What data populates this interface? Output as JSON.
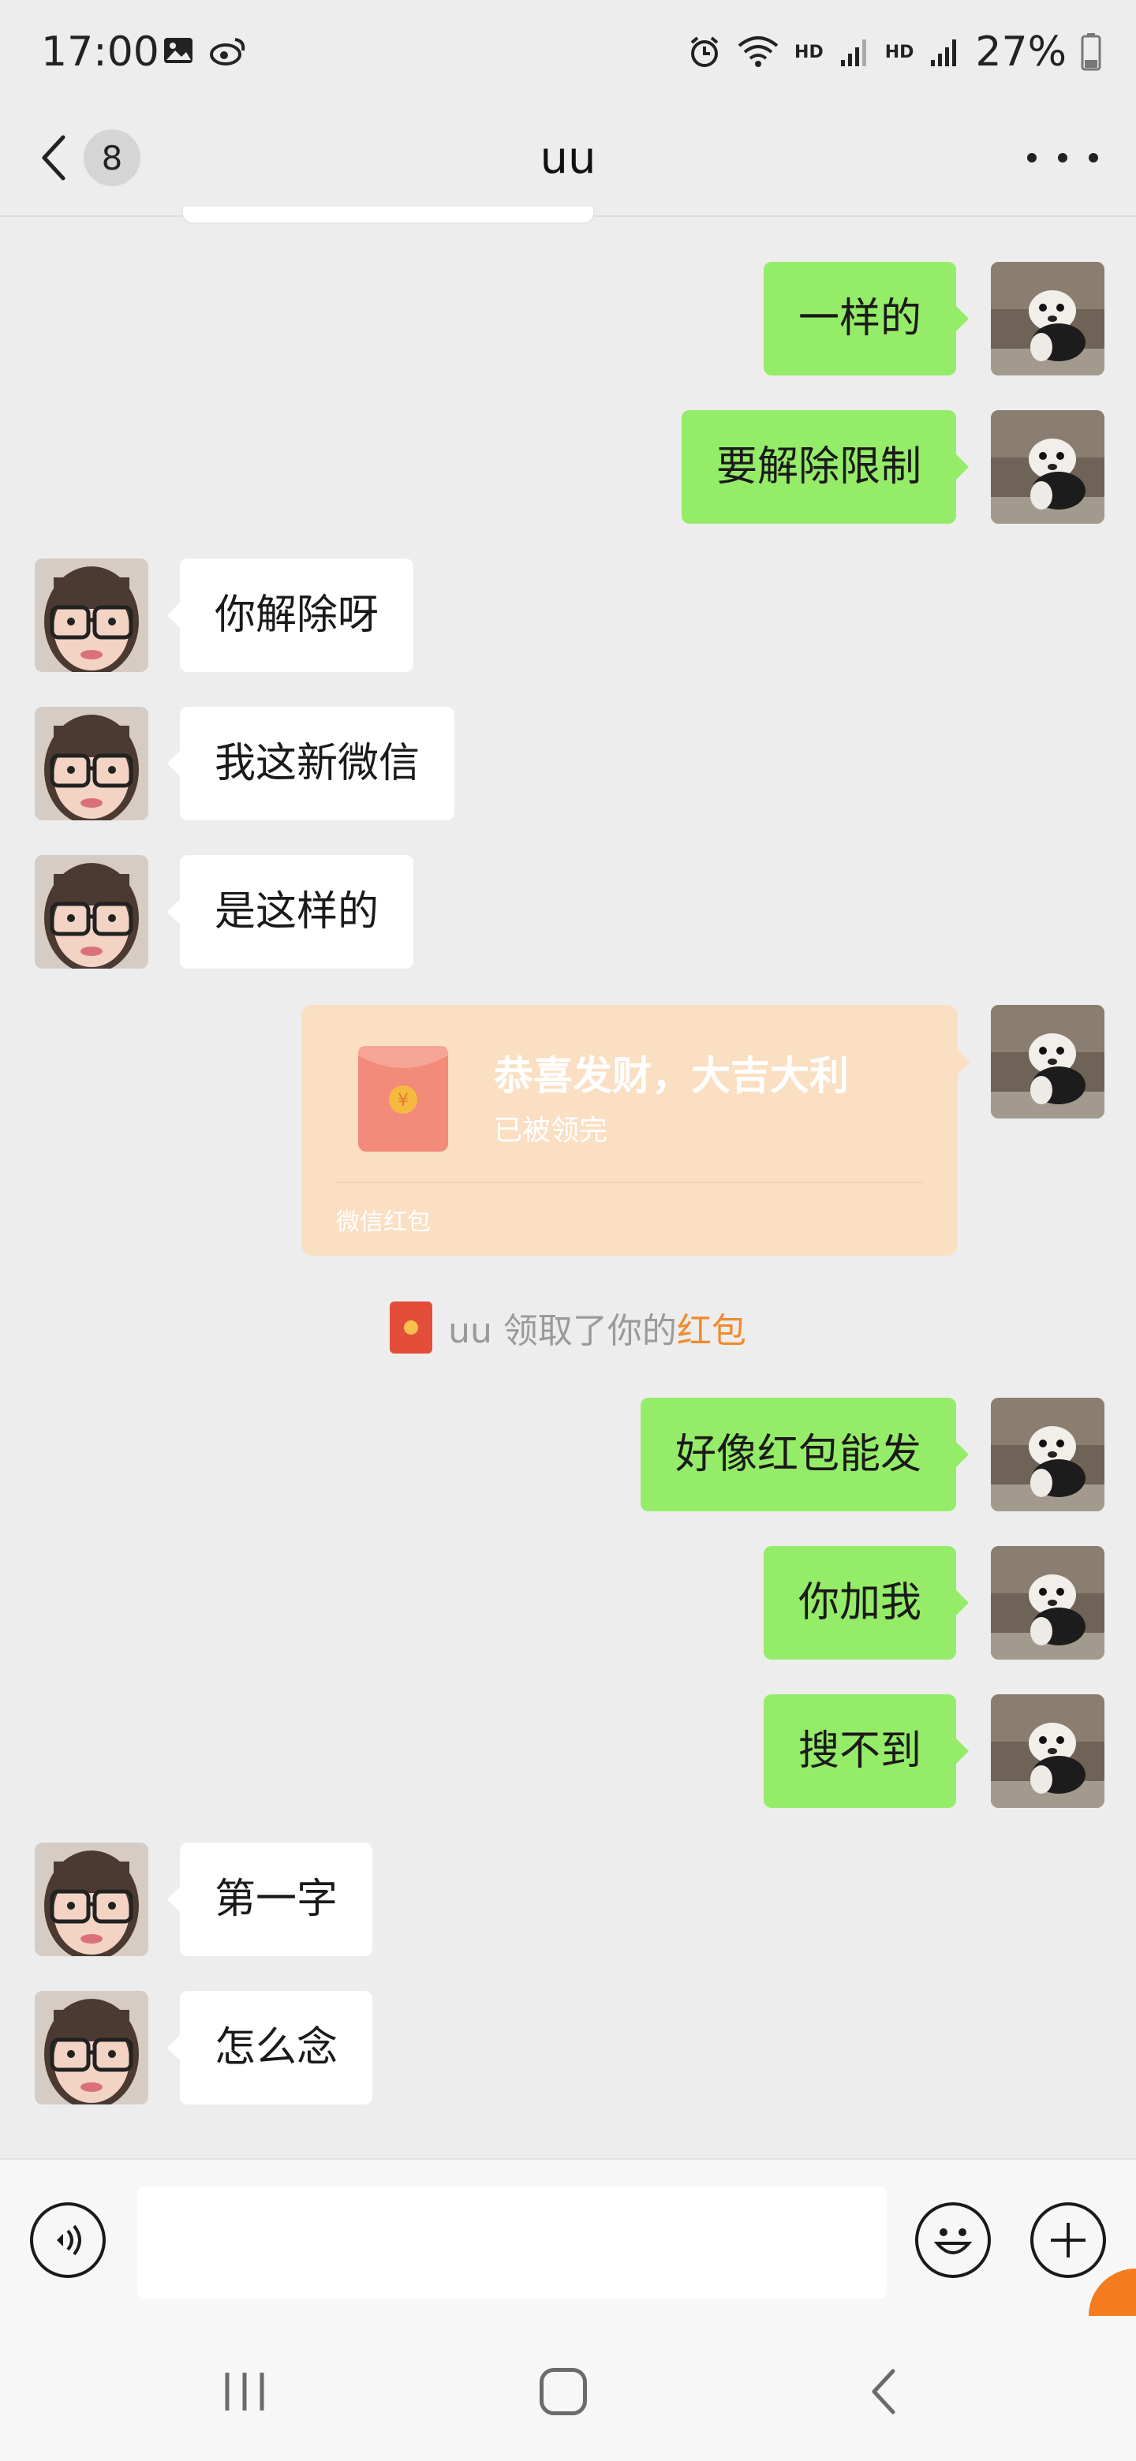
{
  "status_bar": {
    "time": "17:00",
    "hd_label": "HD",
    "battery": "27%"
  },
  "header": {
    "back_count": "8",
    "title": "uu"
  },
  "messages": [
    {
      "side": "me",
      "text": "一样的"
    },
    {
      "side": "me",
      "text": "要解除限制"
    },
    {
      "side": "other",
      "text": "你解除呀"
    },
    {
      "side": "other",
      "text": "我这新微信"
    },
    {
      "side": "other",
      "text": "是这样的"
    },
    {
      "side": "me",
      "text": "好像红包能发"
    },
    {
      "side": "me",
      "text": "你加我"
    },
    {
      "side": "me",
      "text": "搜不到"
    },
    {
      "side": "other",
      "text": "第一字"
    },
    {
      "side": "other",
      "text": "怎么念"
    }
  ],
  "red_packet": {
    "title": "恭喜发财，大吉大利",
    "status": "已被领完",
    "footer": "微信红包",
    "symbol": "¥"
  },
  "notice": {
    "prefix": "uu 领取了你的",
    "link": "红包"
  },
  "input": {
    "value": "",
    "placeholder": ""
  },
  "colors": {
    "my_bubble": "#95ec69",
    "other_bubble": "#ffffff",
    "background": "#ededed",
    "red_packet": "#fbdfc3",
    "notice_link": "#f08b2c"
  },
  "icons": {
    "back": "chevron-left-icon",
    "more": "more-dots-icon",
    "voice": "voice-icon",
    "emoji": "emoji-icon",
    "plus": "plus-icon",
    "nav_recent": "recent-apps-icon",
    "nav_home": "home-icon",
    "nav_back": "nav-back-icon"
  }
}
